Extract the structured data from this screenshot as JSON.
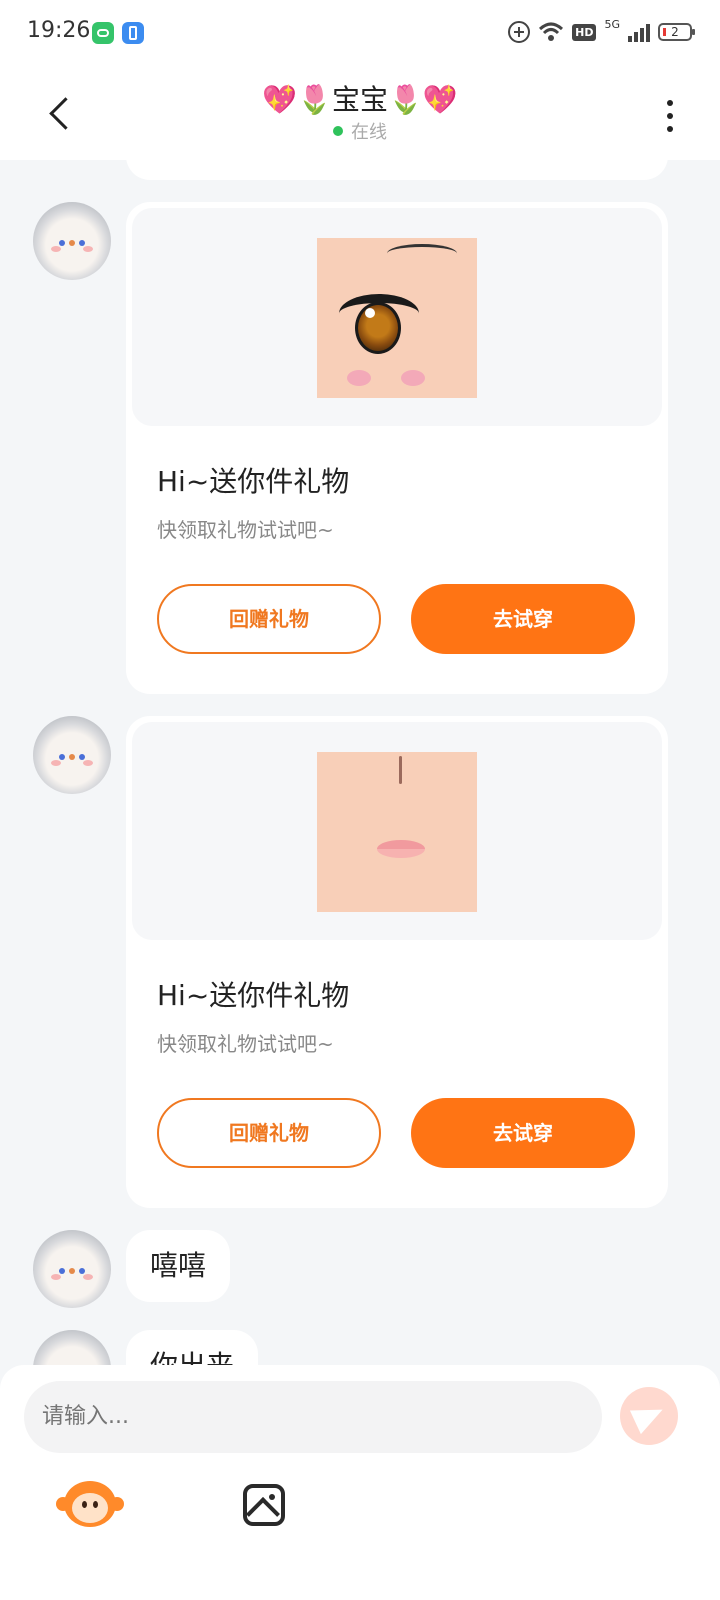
{
  "status_bar": {
    "time": "19:26",
    "network": "5G",
    "hd": "HD",
    "battery": "2"
  },
  "header": {
    "title": "💖🌷宝宝🌷💖",
    "status": "在线"
  },
  "messages": [
    {
      "type": "gift",
      "preview_icon": "anime-eye-makeup",
      "title": "Hi~送你件礼物",
      "subtitle": "快领取礼物试试吧~",
      "return_gift_label": "回赠礼物",
      "try_on_label": "去试穿"
    },
    {
      "type": "gift",
      "preview_icon": "lips-makeup",
      "title": "Hi~送你件礼物",
      "subtitle": "快领取礼物试试吧~",
      "return_gift_label": "回赠礼物",
      "try_on_label": "去试穿"
    },
    {
      "type": "text",
      "text": "嘻嘻"
    },
    {
      "type": "text",
      "text": "你出来"
    }
  ],
  "composer": {
    "placeholder": "请输入..."
  },
  "colors": {
    "accent": "#ff7414",
    "online": "#2fc25b",
    "background": "#f4f6f8"
  }
}
